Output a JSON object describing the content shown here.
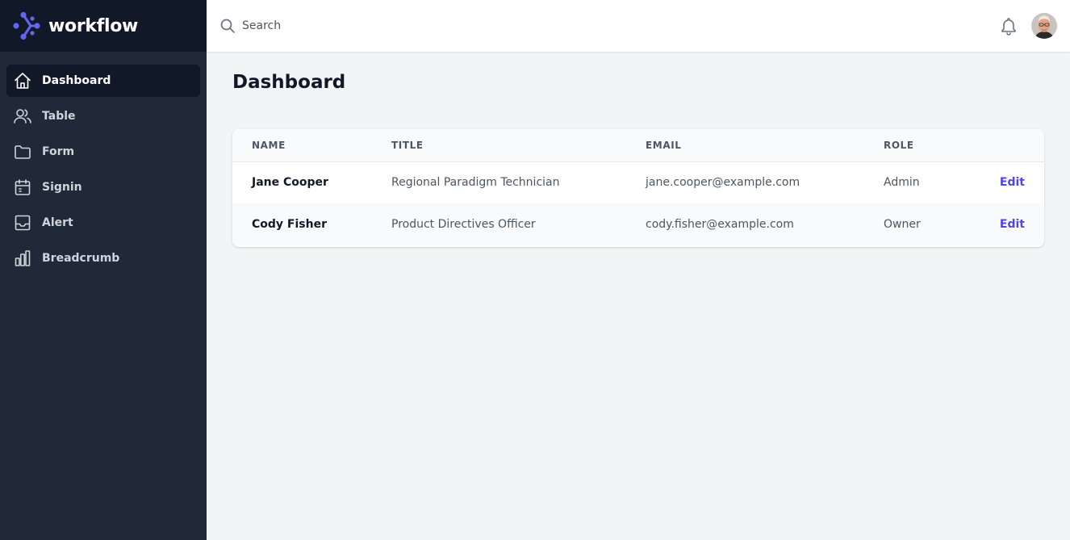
{
  "brand": {
    "name": "workflow",
    "accent": "#6366f1"
  },
  "sidebar": {
    "items": [
      {
        "label": "Dashboard",
        "icon": "home-icon",
        "active": true
      },
      {
        "label": "Table",
        "icon": "users-icon"
      },
      {
        "label": "Form",
        "icon": "folder-icon"
      },
      {
        "label": "Signin",
        "icon": "calendar-icon"
      },
      {
        "label": "Alert",
        "icon": "inbox-icon"
      },
      {
        "label": "Breadcrumb",
        "icon": "chart-bar-icon"
      }
    ]
  },
  "topbar": {
    "search_placeholder": "Search",
    "icons": [
      "search-icon",
      "bell-icon"
    ]
  },
  "main": {
    "title": "Dashboard",
    "table": {
      "headers": [
        "Name",
        "Title",
        "Email",
        "Role"
      ],
      "rows": [
        {
          "name": "Jane Cooper",
          "title": "Regional Paradigm Technician",
          "email": "jane.cooper@example.com",
          "role": "Admin",
          "action": "Edit"
        },
        {
          "name": "Cody Fisher",
          "title": "Product Directives Officer",
          "email": "cody.fisher@example.com",
          "role": "Owner",
          "action": "Edit"
        }
      ]
    }
  },
  "colors": {
    "sidebar_bg": "#1f2937",
    "brand_bg": "#111827",
    "content_bg": "#f3f4f6",
    "link": "#4f46e5"
  }
}
